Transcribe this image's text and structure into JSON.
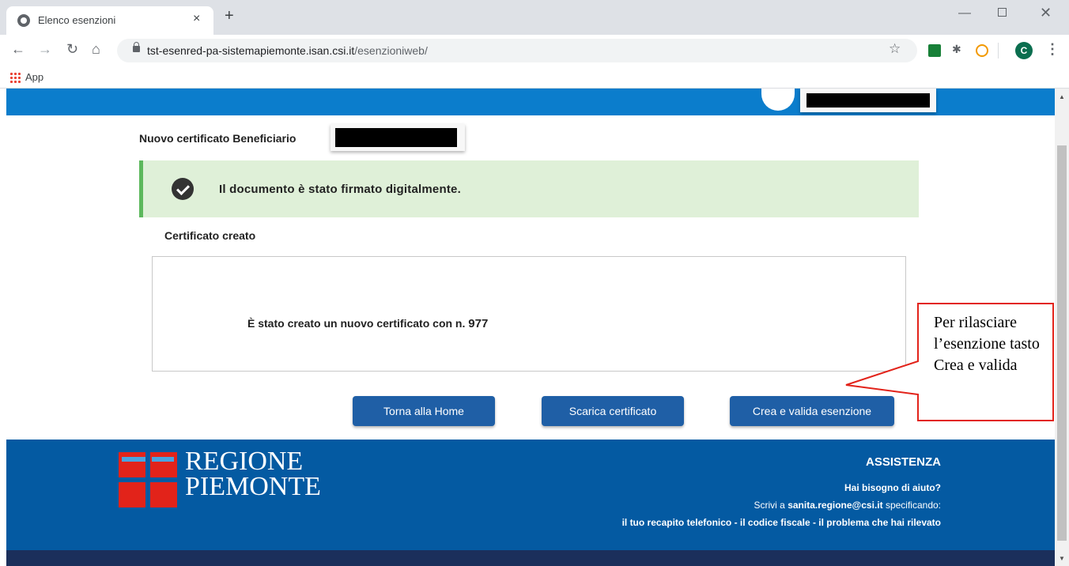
{
  "browser": {
    "tab_title": "Elenco esenzioni",
    "tab_close": "×",
    "new_tab": "+",
    "url_host": "tst-esenred-pa-sistemapiemonte.isan.csi.it",
    "url_path": "/esenzioniweb/",
    "bookmark_apps": "App",
    "profile_initial": "C"
  },
  "page": {
    "title": "Nuovo certificato Beneficiario",
    "alert": "Il documento è stato firmato digitalmente.",
    "section_title": "Certificato creato",
    "cert_message": "È stato creato un nuovo certificato con n.",
    "cert_number": "977"
  },
  "buttons": {
    "home": "Torna alla Home",
    "download": "Scarica certificato",
    "create": "Crea e valida esenzione"
  },
  "footer": {
    "logo_line1": "REGIONE",
    "logo_line2": "PIEMONTE",
    "assist_title": "ASSISTENZA",
    "assist_question": "Hai bisogno di aiuto?",
    "assist_prefix": "Scrivi a",
    "assist_email": "sanita.regione@csi.it",
    "assist_suffix": "specificando:",
    "assist_details": "il tuo recapito telefonico - il codice fiscale - il problema che hai rilevato"
  },
  "callout": {
    "text": "Per rilasciare l’esenzione tasto Crea e valida"
  },
  "colors": {
    "header_blue": "#0b7dcc",
    "button_blue": "#1f5fa6",
    "footer_blue": "#045aa2",
    "alert_green": "#dff0d8",
    "callout_red": "#e2231a"
  }
}
